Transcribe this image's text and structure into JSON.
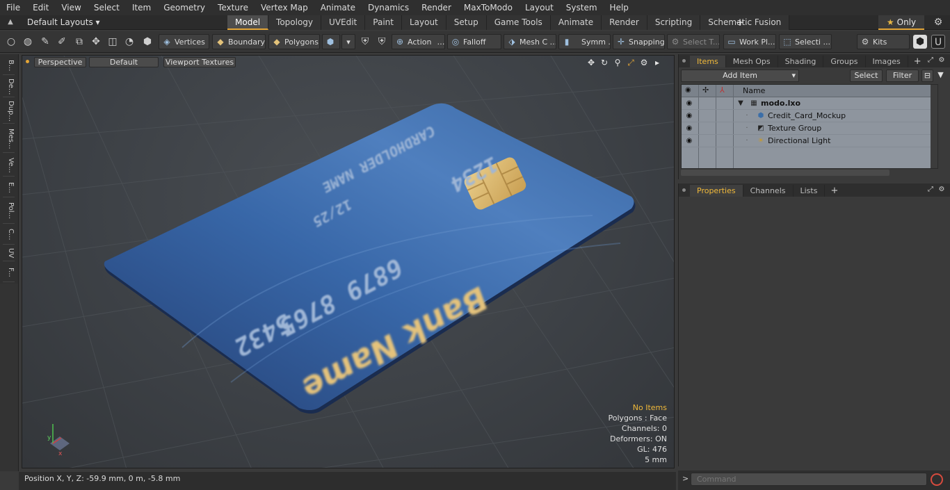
{
  "menu": [
    "File",
    "Edit",
    "View",
    "Select",
    "Item",
    "Geometry",
    "Texture",
    "Vertex Map",
    "Animate",
    "Dynamics",
    "Render",
    "MaxToModo",
    "Layout",
    "System",
    "Help"
  ],
  "layout_bar": {
    "layout_select": "Default Layouts ▾",
    "tabs": [
      "Model",
      "Topology",
      "UVEdit",
      "Paint",
      "Layout",
      "Setup",
      "Game Tools",
      "Animate",
      "Render",
      "Scripting",
      "Schematic Fusion"
    ],
    "active_tab": "Model",
    "add_tab": "+",
    "only_label": "Only"
  },
  "toolbar": {
    "vertices": "Vertices",
    "boundary": "Boundary",
    "polygons": "Polygons",
    "action": "Action",
    "falloff": "Falloff",
    "mesh": "Mesh C ...",
    "symm": "Symm ...",
    "snapping": "Snapping",
    "select_t": "Select T...",
    "work_pl": "Work Pl...",
    "selecti": "Selecti ...",
    "kits": "Kits"
  },
  "left_tabs": [
    "B...",
    "De...",
    "Dup...",
    "Mes...",
    "Ve...",
    "E...",
    "Pol...",
    "C...",
    "UV",
    "F..."
  ],
  "viewport": {
    "view_mode": "Perspective",
    "shading": "Default",
    "textures": "Viewport Textures",
    "card": {
      "bank_name": "Bank Name",
      "number": "5432 6879 8765 1234",
      "line_number_1": "5432",
      "line_number_2": "6879 8765",
      "line_number_3": "1234",
      "date": "12/25",
      "holder": "CARDHOLDER NAME"
    },
    "info": {
      "no_items": "No Items",
      "polygons": "Polygons : Face",
      "channels": "Channels: 0",
      "deformers": "Deformers: ON",
      "gl": "GL: 476",
      "scale": "5 mm"
    },
    "axis_y": "y",
    "axis_x": "x"
  },
  "status": {
    "position": "Position X, Y, Z:   -59.9 mm, 0 m, -5.8 mm"
  },
  "items_panel": {
    "tabs": [
      "Items",
      "Mesh Ops",
      "Shading",
      "Groups",
      "Images"
    ],
    "active_tab": "Items",
    "add_item": "Add Item",
    "select": "Select",
    "filter": "Filter",
    "column_name": "Name",
    "rows": [
      {
        "label": "modo.lxo",
        "bold": true
      },
      {
        "label": "Credit_Card_Mockup",
        "bold": false
      },
      {
        "label": "Texture Group",
        "bold": false
      },
      {
        "label": "Directional Light",
        "bold": false
      }
    ]
  },
  "properties_panel": {
    "tabs": [
      "Properties",
      "Channels",
      "Lists"
    ],
    "active_tab": "Properties"
  },
  "command": {
    "placeholder": "Command"
  },
  "colors": {
    "accent": "#e3a536",
    "card_blue": "#2f5d9c",
    "chip_gold": "#d9b46a"
  }
}
